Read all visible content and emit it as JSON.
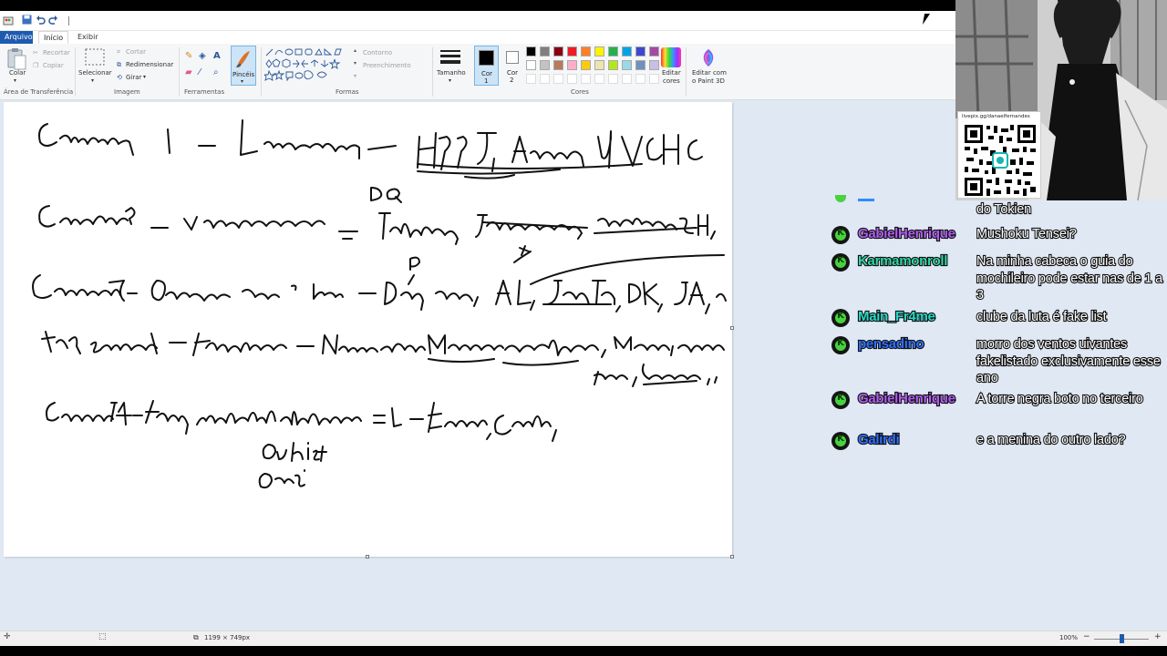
{
  "ribbon": {
    "tabs": [
      "Arquivo",
      "Início",
      "Exibir"
    ],
    "clipboard": {
      "paste": "Colar",
      "cut": "Recortar",
      "copy": "Copiar",
      "group": "Área de Transferência"
    },
    "image": {
      "select": "Selecionar",
      "crop": "Cortar",
      "resize": "Redimensionar",
      "rotate": "Girar",
      "group": "Imagem"
    },
    "tools": {
      "group": "Ferramentas",
      "brushes": "Pincéis"
    },
    "shapes": {
      "outline": "Contorno",
      "fill": "Preenchimento",
      "group": "Formas"
    },
    "size": "Tamanho",
    "color1": "Cor",
    "color1_num": "1",
    "color2": "Cor",
    "color2_num": "2",
    "colors_group": "Cores",
    "edit_colors": "Editar",
    "edit_colors2": "cores",
    "paint3d": "Editar com",
    "paint3d2": "o Paint 3D"
  },
  "palette": [
    "#000000",
    "#7f7f7f",
    "#880015",
    "#ed1c24",
    "#ff7f27",
    "#fff200",
    "#22b14c",
    "#00a2e8",
    "#3f48cc",
    "#a349a4",
    "#ffffff",
    "#c3c3c3",
    "#b97a57",
    "#ffaec9",
    "#ffc90e",
    "#efe4b0",
    "#b5e61d",
    "#99d9ea",
    "#7092be",
    "#c8bfe7"
  ],
  "status": {
    "dimensions": "1199 × 749px",
    "zoom": "100%"
  },
  "qr": {
    "url": "livepix.gg/danaelfernandes"
  },
  "chat": {
    "partial": "do Tokien",
    "messages": [
      {
        "user": "GabielHenrique",
        "color": "#b05cf0",
        "text": "Mushoku Tensei?"
      },
      {
        "user": "Karmamonroll",
        "color": "#2fd6a8",
        "text": "Na minha cabeca o guia do mochileiro pode estar nas de 1 a 3"
      },
      {
        "user": "Main_Fr4me",
        "color": "#27d9c7",
        "text": "clube da luta é fake list"
      },
      {
        "user": "pensadino",
        "color": "#2f6fff",
        "text": "morro dos ventos uivantes fakelistado exclusivamente esse ano"
      },
      {
        "user": "GabielHenrique",
        "color": "#b05cf0",
        "text": "A torre negra boto no terceiro"
      },
      {
        "user": "Galirdi",
        "color": "#2f6fff",
        "text": "e a menina do outro lado?"
      }
    ]
  },
  "icons": [
    "paint-app-icon",
    "save-icon",
    "undo-icon",
    "redo-icon",
    "paste-icon",
    "cut-icon",
    "copy-icon",
    "select-icon",
    "crop-icon",
    "resize-icon",
    "rotate-icon",
    "pencil-icon",
    "fill-icon",
    "text-icon",
    "eraser-icon",
    "picker-icon",
    "magnifier-icon",
    "brush-icon",
    "size-icon",
    "edit-colors-icon",
    "paint3d-icon",
    "cursor-icon",
    "dimensions-icon",
    "selection-icon"
  ]
}
